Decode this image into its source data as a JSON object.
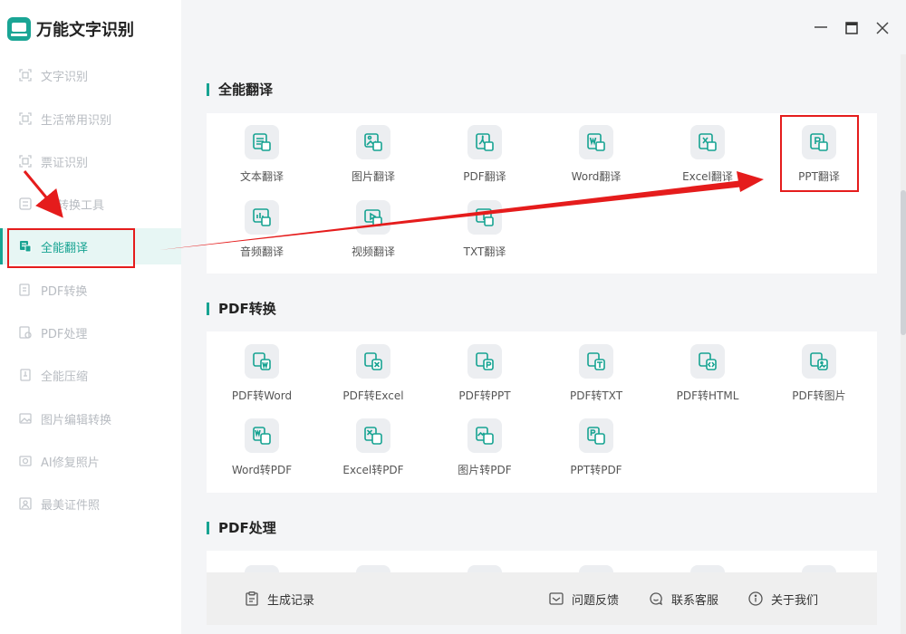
{
  "app": {
    "title": "万能文字识别"
  },
  "window_controls": {
    "minimize_icon": "minimize-icon",
    "maximize_icon": "maximize-icon",
    "close_icon": "close-icon"
  },
  "sidebar": {
    "items": [
      {
        "label": "文字识别",
        "icon": "scan-icon",
        "active": false
      },
      {
        "label": "生活常用识别",
        "icon": "scan-icon",
        "active": false
      },
      {
        "label": "票证识别",
        "icon": "scan-icon",
        "active": false
      },
      {
        "label": "转换工具",
        "icon": "convert-icon",
        "active": false
      },
      {
        "label": "全能翻译",
        "icon": "translate-icon",
        "active": true
      },
      {
        "label": "PDF转换",
        "icon": "pdf-convert-icon",
        "active": false
      },
      {
        "label": "PDF处理",
        "icon": "pdf-process-icon",
        "active": false
      },
      {
        "label": "全能压缩",
        "icon": "compress-icon",
        "active": false
      },
      {
        "label": "图片编辑转换",
        "icon": "image-edit-icon",
        "active": false
      },
      {
        "label": "AI修复照片",
        "icon": "photo-fix-icon",
        "active": false
      },
      {
        "label": "最美证件照",
        "icon": "id-photo-icon",
        "active": false
      }
    ]
  },
  "sections": [
    {
      "title": "全能翻译",
      "tools": [
        {
          "label": "文本翻译",
          "icon": "text-translate-icon"
        },
        {
          "label": "图片翻译",
          "icon": "image-translate-icon"
        },
        {
          "label": "PDF翻译",
          "icon": "pdf-translate-icon"
        },
        {
          "label": "Word翻译",
          "icon": "word-translate-icon"
        },
        {
          "label": "Excel翻译",
          "icon": "excel-translate-icon"
        },
        {
          "label": "PPT翻译",
          "icon": "ppt-translate-icon"
        },
        {
          "label": "音频翻译",
          "icon": "audio-translate-icon"
        },
        {
          "label": "视频翻译",
          "icon": "video-translate-icon"
        },
        {
          "label": "TXT翻译",
          "icon": "txt-translate-icon"
        }
      ]
    },
    {
      "title": "PDF转换",
      "tools": [
        {
          "label": "PDF转Word",
          "icon": "pdf-to-word-icon"
        },
        {
          "label": "PDF转Excel",
          "icon": "pdf-to-excel-icon"
        },
        {
          "label": "PDF转PPT",
          "icon": "pdf-to-ppt-icon"
        },
        {
          "label": "PDF转TXT",
          "icon": "pdf-to-txt-icon"
        },
        {
          "label": "PDF转HTML",
          "icon": "pdf-to-html-icon"
        },
        {
          "label": "PDF转图片",
          "icon": "pdf-to-image-icon"
        },
        {
          "label": "Word转PDF",
          "icon": "word-to-pdf-icon"
        },
        {
          "label": "Excel转PDF",
          "icon": "excel-to-pdf-icon"
        },
        {
          "label": "图片转PDF",
          "icon": "image-to-pdf-icon"
        },
        {
          "label": "PPT转PDF",
          "icon": "ppt-to-pdf-icon"
        }
      ]
    },
    {
      "title": "PDF处理",
      "tools": []
    }
  ],
  "footer": {
    "records": {
      "label": "生成记录",
      "icon": "clipboard-icon"
    },
    "feedback": {
      "label": "问题反馈",
      "icon": "feedback-icon"
    },
    "support": {
      "label": "联系客服",
      "icon": "chat-icon"
    },
    "about": {
      "label": "关于我们",
      "icon": "info-icon"
    }
  },
  "colors": {
    "accent": "#17a392",
    "annotation": "#e51c1c"
  }
}
